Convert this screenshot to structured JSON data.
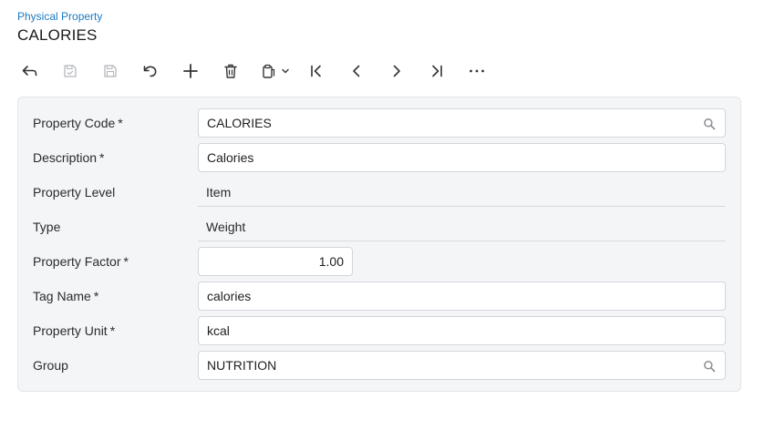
{
  "header": {
    "breadcrumb": "Physical Property",
    "title": "CALORIES"
  },
  "toolbar": {
    "buttons": [
      {
        "name": "back",
        "icon": "back-arrow-icon",
        "enabled": true
      },
      {
        "name": "save-and-close",
        "icon": "save-close-icon",
        "enabled": false
      },
      {
        "name": "save",
        "icon": "save-icon",
        "enabled": false
      },
      {
        "name": "undo",
        "icon": "undo-icon",
        "enabled": true
      },
      {
        "name": "add",
        "icon": "plus-icon",
        "enabled": true
      },
      {
        "name": "delete",
        "icon": "trash-icon",
        "enabled": true
      },
      {
        "name": "copy-paste",
        "icon": "clipboard-icon",
        "enabled": true
      },
      {
        "name": "first",
        "icon": "first-record-icon",
        "enabled": true
      },
      {
        "name": "previous",
        "icon": "chevron-left-icon",
        "enabled": true
      },
      {
        "name": "next",
        "icon": "chevron-right-icon",
        "enabled": true
      },
      {
        "name": "last",
        "icon": "last-record-icon",
        "enabled": true
      },
      {
        "name": "more",
        "icon": "ellipsis-icon",
        "enabled": true
      }
    ]
  },
  "form": {
    "property_code": {
      "label": "Property Code",
      "required": "*",
      "value": "CALORIES"
    },
    "description": {
      "label": "Description",
      "required": "*",
      "value": "Calories"
    },
    "property_level": {
      "label": "Property Level",
      "value": "Item"
    },
    "type": {
      "label": "Type",
      "value": "Weight"
    },
    "property_factor": {
      "label": "Property Factor",
      "required": "*",
      "value": "1.00"
    },
    "tag_name": {
      "label": "Tag Name",
      "required": "*",
      "value": "calories"
    },
    "property_unit": {
      "label": "Property Unit",
      "required": "*",
      "value": "kcal"
    },
    "group": {
      "label": "Group",
      "value": "NUTRITION"
    }
  },
  "colors": {
    "link": "#1d7bc1",
    "panel_bg": "#f4f5f7",
    "icon": "#333333",
    "icon_disabled": "#b5b8bc"
  }
}
